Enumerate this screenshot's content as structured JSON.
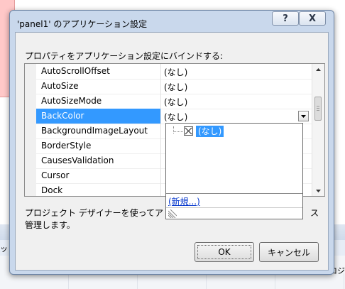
{
  "background": {
    "strip_text": "ッ↑",
    "strip_text_right": "ロジ"
  },
  "dialog": {
    "title": "'panel1' のアプリケーション設定",
    "help_glyph": "?",
    "close_glyph": "X",
    "instruction": "プロパティをアプリケーション設定にバインドする:",
    "properties": [
      {
        "name": "AutoScrollOffset",
        "value": "(なし)"
      },
      {
        "name": "AutoSize",
        "value": "(なし)"
      },
      {
        "name": "AutoSizeMode",
        "value": "(なし)"
      },
      {
        "name": "BackColor",
        "value": "(なし)"
      },
      {
        "name": "BackgroundImageLayout",
        "value": ""
      },
      {
        "name": "BorderStyle",
        "value": ""
      },
      {
        "name": "CausesValidation",
        "value": ""
      },
      {
        "name": "Cursor",
        "value": ""
      },
      {
        "name": "Dock",
        "value": ""
      }
    ],
    "description_line1": "プロジェクト デザイナーを使って",
    "description_line1_tail": "ア",
    "description_line1_end": "ス",
    "description_line2": "管理します。",
    "ok_label": "OK",
    "cancel_label": "キャンセル",
    "popup": {
      "node_label": "(なし)",
      "new_link": "(新規...)"
    }
  }
}
